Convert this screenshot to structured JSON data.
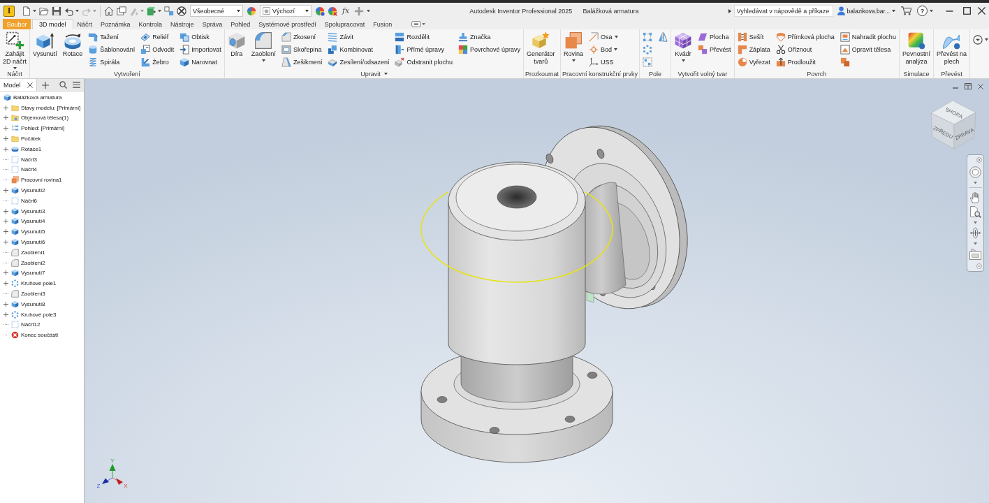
{
  "window": {
    "app_logo": "I",
    "app_title": "Autodesk Inventor Professional 2025",
    "document_title": "Balážková armatura"
  },
  "quick_access": {
    "style": "Všeobecné",
    "appearance": "Výchozí",
    "parameters": "fx",
    "redo_disabled": true,
    "rebuild_disabled": true
  },
  "search": {
    "placeholder": "Vyhledávat v nápovědě a příkaze"
  },
  "user": {
    "name": "balazikova.bar..."
  },
  "help": {
    "label": "?"
  },
  "file_tab": {
    "label": "Soubor"
  },
  "tabs": [
    {
      "label": "3D model",
      "selected": true
    },
    {
      "label": "Náčrt",
      "selected": false
    },
    {
      "label": "Poznámka",
      "selected": false
    },
    {
      "label": "Kontrola",
      "selected": false
    },
    {
      "label": "Nástroje",
      "selected": false
    },
    {
      "label": "Správa",
      "selected": false
    },
    {
      "label": "Pohled",
      "selected": false
    },
    {
      "label": "Systémové prostředí",
      "selected": false
    },
    {
      "label": "Spolupracovat",
      "selected": false
    },
    {
      "label": "Fusion",
      "selected": false
    }
  ],
  "ribbon": {
    "panels": [
      {
        "label": "Náčrt",
        "has_menu": false,
        "groups": [
          {
            "kind": "large",
            "label": "Zahájit\n2D náčrt",
            "has_menu": true
          }
        ]
      },
      {
        "label": "Vytvoření",
        "has_menu": false,
        "groups": [
          {
            "kind": "large",
            "label": "Vysunutí",
            "has_menu": false
          },
          {
            "kind": "large",
            "label": "Rotace",
            "has_menu": false
          },
          {
            "kind": "column",
            "buttons": [
              {
                "label": "Tažení",
                "has_menu": false
              },
              {
                "label": "Šablonování",
                "has_menu": false
              },
              {
                "label": "Spirála",
                "has_menu": false
              }
            ]
          },
          {
            "kind": "column",
            "buttons": [
              {
                "label": "Reliéf",
                "has_menu": false
              },
              {
                "label": "Odvodit",
                "has_menu": false
              },
              {
                "label": "Žebro",
                "has_menu": false
              }
            ]
          },
          {
            "kind": "column",
            "buttons": [
              {
                "label": "Obtisk",
                "has_menu": false
              },
              {
                "label": "Importovat",
                "has_menu": false
              },
              {
                "label": "Narovnat",
                "has_menu": false
              }
            ]
          }
        ]
      },
      {
        "label": "Upravit",
        "has_menu": true,
        "groups": [
          {
            "kind": "large",
            "label": "Díra",
            "has_menu": false
          },
          {
            "kind": "large",
            "label": "Zaoblení",
            "has_menu": true
          },
          {
            "kind": "column",
            "buttons": [
              {
                "label": "Zkosení",
                "has_menu": false
              },
              {
                "label": "Skořepina",
                "has_menu": false
              },
              {
                "label": "Zešikmení",
                "has_menu": false
              }
            ]
          },
          {
            "kind": "column",
            "buttons": [
              {
                "label": "Závit",
                "has_menu": false
              },
              {
                "label": "Kombinovat",
                "has_menu": false
              },
              {
                "label": "Zesílení/odsazení",
                "has_menu": false
              }
            ]
          },
          {
            "kind": "column",
            "buttons": [
              {
                "label": "Rozdělit",
                "has_menu": false
              },
              {
                "label": "Přímé úpravy",
                "has_menu": false
              },
              {
                "label": "Odstranit plochu",
                "has_menu": false
              }
            ]
          },
          {
            "kind": "column",
            "buttons": [
              {
                "label": "Značka",
                "has_menu": false
              },
              {
                "label": "Povrchové úpravy",
                "has_menu": false
              }
            ]
          }
        ]
      },
      {
        "label": "Prozkoumat",
        "has_menu": false,
        "groups": [
          {
            "kind": "large",
            "label": "Generátor\ntvarů",
            "has_menu": false
          }
        ]
      },
      {
        "label": "Pracovní konstrukční prvky",
        "has_menu": false,
        "groups": [
          {
            "kind": "large",
            "label": "Rovina",
            "has_menu": true
          },
          {
            "kind": "column",
            "buttons": [
              {
                "label": "Osa",
                "has_menu": true
              },
              {
                "label": "Bod",
                "has_menu": true
              },
              {
                "label": "USS",
                "has_menu": false
              }
            ]
          }
        ]
      },
      {
        "label": "Pole",
        "has_menu": false,
        "groups": [
          {
            "kind": "column",
            "buttons": [
              {
                "has_menu": false
              },
              {
                "has_menu": false
              },
              {
                "has_menu": false
              }
            ]
          },
          {
            "kind": "column",
            "buttons": [
              {
                "has_menu": false
              }
            ]
          }
        ]
      },
      {
        "label": "Vytvořit volný tvar",
        "has_menu": false,
        "groups": [
          {
            "kind": "large",
            "label": "Kvádr",
            "has_menu": true
          },
          {
            "kind": "column",
            "buttons": [
              {
                "label": "Plocha",
                "has_menu": false
              },
              {
                "label": "Převést",
                "has_menu": false
              }
            ]
          }
        ]
      },
      {
        "label": "Povrch",
        "has_menu": false,
        "groups": [
          {
            "kind": "column",
            "buttons": [
              {
                "label": "Sešít",
                "has_menu": false
              },
              {
                "label": "Záplata",
                "has_menu": false
              },
              {
                "label": "Vyřezat",
                "has_menu": false
              }
            ]
          },
          {
            "kind": "column",
            "buttons": [
              {
                "label": "Přímková plocha",
                "has_menu": false
              },
              {
                "label": "Oříznout",
                "has_menu": false
              },
              {
                "label": "Prodloužit",
                "has_menu": false
              }
            ]
          },
          {
            "kind": "column",
            "buttons": [
              {
                "label": "Nahradit plochu",
                "has_menu": false
              },
              {
                "label": "Opravit tělesa",
                "has_menu": false
              },
              {
                "has_menu": false
              }
            ]
          }
        ]
      },
      {
        "label": "Simulace",
        "has_menu": false,
        "groups": [
          {
            "kind": "large",
            "label": "Pevnostní\nanalýza",
            "has_menu": false
          }
        ]
      },
      {
        "label": "Převést",
        "has_menu": false,
        "groups": [
          {
            "kind": "large",
            "label": "Převést na\nplech",
            "has_menu": false
          }
        ]
      },
      {
        "groups": [
          {
            "kind": "icon",
            "has_menu": true
          }
        ]
      }
    ]
  },
  "browser": {
    "tab": "Model",
    "tree": {
      "label": "Balážková armatura",
      "kind": "part",
      "children": [
        {
          "label": "Stavy modelu: [Primární]",
          "kind": "folder",
          "expandable": true
        },
        {
          "label": "Objemová tělesa(1)",
          "kind": "bodies",
          "expandable": true
        },
        {
          "label": "Pohled: [Primární]",
          "kind": "view",
          "expandable": true
        },
        {
          "label": "Počátek",
          "kind": "folder",
          "expandable": true
        },
        {
          "label": "Rotace1",
          "kind": "revolve",
          "expandable": true
        },
        {
          "label": "Náčrt3",
          "kind": "sketch",
          "expandable": false
        },
        {
          "label": "Náčrt4",
          "kind": "sketch",
          "expandable": false
        },
        {
          "label": "Pracovní rovina1",
          "kind": "work_plane",
          "expandable": false
        },
        {
          "label": "Vysunutí2",
          "kind": "extrude",
          "expandable": true
        },
        {
          "label": "Náčrt6",
          "kind": "sketch",
          "expandable": false
        },
        {
          "label": "Vysunutí3",
          "kind": "extrude",
          "expandable": true
        },
        {
          "label": "Vysunutí4",
          "kind": "extrude",
          "expandable": true
        },
        {
          "label": "Vysunutí5",
          "kind": "extrude",
          "expandable": true
        },
        {
          "label": "Vysunutí6",
          "kind": "extrude",
          "expandable": true
        },
        {
          "label": "Zaoblení1",
          "kind": "fillet",
          "expandable": false
        },
        {
          "label": "Zaoblení2",
          "kind": "fillet",
          "expandable": false
        },
        {
          "label": "Vysunutí7",
          "kind": "extrude",
          "expandable": true
        },
        {
          "label": "Kruhové pole1",
          "kind": "pattern",
          "expandable": true
        },
        {
          "label": "Zaoblení3",
          "kind": "fillet",
          "expandable": false
        },
        {
          "label": "Vysunutí8",
          "kind": "extrude",
          "expandable": true
        },
        {
          "label": "Kruhové pole3",
          "kind": "pattern",
          "expandable": true
        },
        {
          "label": "Náčrt12",
          "kind": "sketch",
          "expandable": false
        },
        {
          "label": "Konec součásti",
          "kind": "end",
          "expandable": false
        }
      ]
    }
  },
  "viewport": {
    "view_cube": {
      "top": "SHORA",
      "front": "ZPŘEDU",
      "right": "ZPRAVA"
    },
    "triad": {
      "x": "X",
      "y": "Y",
      "z": "Z"
    }
  }
}
